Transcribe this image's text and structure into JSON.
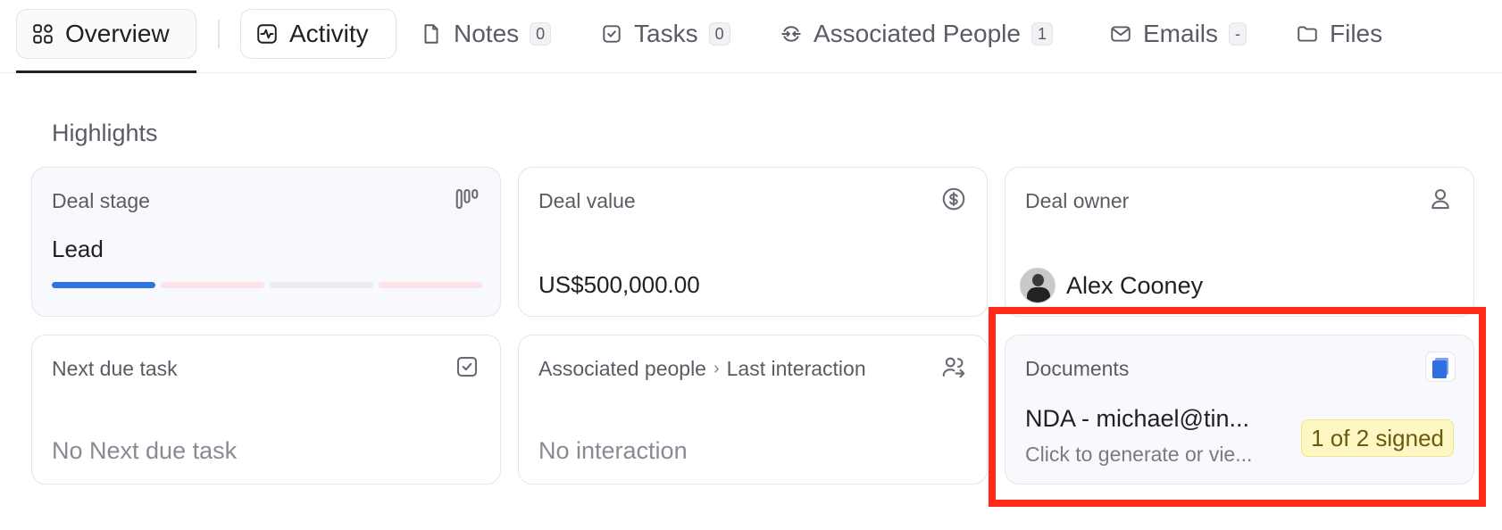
{
  "tabs": [
    {
      "id": "overview",
      "label": "Overview",
      "icon": "layout-grid-icon"
    },
    {
      "id": "activity",
      "label": "Activity",
      "icon": "activity-icon"
    },
    {
      "id": "notes",
      "label": "Notes",
      "count": "0",
      "icon": "note-icon"
    },
    {
      "id": "tasks",
      "label": "Tasks",
      "count": "0",
      "icon": "checkbox-icon"
    },
    {
      "id": "associated_people",
      "label": "Associated People",
      "count": "1",
      "icon": "arrows-exchange-icon"
    },
    {
      "id": "emails",
      "label": "Emails",
      "count": "-",
      "icon": "mail-icon"
    },
    {
      "id": "files",
      "label": "Files",
      "icon": "folder-icon"
    }
  ],
  "active_tab": "Overview",
  "highlights": {
    "title": "Highlights",
    "deal_stage": {
      "label": "Deal stage",
      "value": "Lead",
      "icon": "kanban-icon",
      "stages_total": 4,
      "stage_colors": [
        "#2f74e0",
        "#fde3e8",
        "#ececef",
        "#fde3e8"
      ]
    },
    "deal_value": {
      "label": "Deal value",
      "value": "US$500,000.00",
      "icon": "dollar-circle-icon"
    },
    "deal_owner": {
      "label": "Deal owner",
      "name": "Alex Cooney",
      "icon": "user-icon"
    },
    "next_due_task": {
      "label": "Next due task",
      "empty_text": "No Next due task",
      "icon": "checkbox-icon"
    },
    "associated_people": {
      "label": "Associated people",
      "sublabel": "Last interaction",
      "empty_text": "No interaction",
      "icon": "users-icon"
    },
    "documents": {
      "label": "Documents",
      "doc_title": "NDA - michael@tin...",
      "doc_subtitle": "Click to generate or vie...",
      "status": "1 of 2 signed",
      "icon": "document-icon"
    }
  },
  "colors": {
    "accent": "#2f74e0",
    "highlight_frame": "#ff2a17",
    "badge_bg": "#fdf7c3",
    "badge_text": "#6a5a10"
  }
}
